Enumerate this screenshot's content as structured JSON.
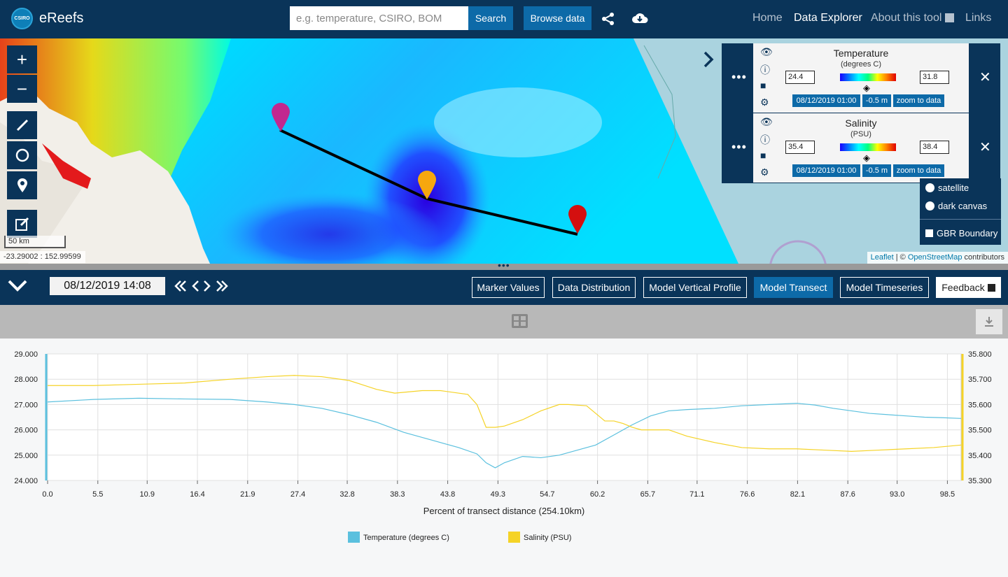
{
  "header": {
    "brand": "eReefs",
    "logo_text": "CSIRO",
    "search_placeholder": "e.g. temperature, CSIRO, BOM",
    "search_button": "Search",
    "browse_button": "Browse data",
    "nav": [
      "Home",
      "Data Explorer",
      "About this tool",
      "Links"
    ],
    "active_nav": "Data Explorer"
  },
  "map": {
    "scale_label": "50 km",
    "coords": "-23.29002 : 152.99599",
    "attribution_leaflet": "Leaflet",
    "attribution_sep": " | © ",
    "attribution_osm": "OpenStreetMap",
    "attribution_tail": " contributors",
    "markers": [
      "magenta",
      "orange",
      "red"
    ]
  },
  "layers": [
    {
      "title": "Temperature",
      "unit": "(degrees C)",
      "min": "24.4",
      "max": "31.8",
      "date": "08/12/2019 01:00",
      "depth": "-0.5 m",
      "zoom": "zoom to data"
    },
    {
      "title": "Salinity",
      "unit": "(PSU)",
      "min": "35.4",
      "max": "38.4",
      "date": "08/12/2019 01:00",
      "depth": "-0.5 m",
      "zoom": "zoom to data"
    }
  ],
  "basemap_options": [
    "satellite",
    "dark canvas",
    "GBR Boundary"
  ],
  "controls": {
    "datetime": "08/12/2019 14:08",
    "tabs": [
      "Marker Values",
      "Data Distribution",
      "Model Vertical Profile",
      "Model Transect",
      "Model Timeseries"
    ],
    "active_tab": "Model Transect",
    "feedback": "Feedback"
  },
  "chart_data": {
    "type": "line",
    "xlabel": "Percent of transect distance (254.10km)",
    "x_ticks": [
      "0.0",
      "5.5",
      "10.9",
      "16.4",
      "21.9",
      "27.4",
      "32.8",
      "38.3",
      "43.8",
      "49.3",
      "54.7",
      "60.2",
      "65.7",
      "71.1",
      "76.6",
      "82.1",
      "87.6",
      "93.0",
      "98.5"
    ],
    "xlim": [
      0,
      100
    ],
    "y_left_ticks": [
      "29.000",
      "28.000",
      "27.000",
      "26.000",
      "25.000",
      "24.000"
    ],
    "y_left_range": [
      24,
      29
    ],
    "y_right_ticks": [
      "35.800",
      "35.700",
      "35.600",
      "35.500",
      "35.400",
      "35.300"
    ],
    "y_right_range": [
      35.3,
      35.8
    ],
    "grid": true,
    "legend_position": "bottom",
    "series": [
      {
        "name": "Temperature (degrees C)",
        "color": "#5bc0de",
        "axis": "left",
        "x": [
          0,
          5,
          10,
          15,
          20,
          24,
          27,
          30,
          33,
          36,
          39,
          42,
          45,
          47,
          48,
          49,
          50,
          52,
          54,
          56,
          58,
          60,
          62,
          64,
          66,
          68,
          70,
          73,
          76,
          79,
          82,
          84,
          86,
          88,
          90,
          92,
          94,
          96,
          98,
          100
        ],
        "y": [
          27.1,
          27.2,
          27.25,
          27.22,
          27.2,
          27.1,
          27.0,
          26.85,
          26.6,
          26.3,
          25.9,
          25.6,
          25.3,
          25.05,
          24.7,
          24.5,
          24.7,
          24.95,
          24.9,
          25.0,
          25.2,
          25.4,
          25.8,
          26.2,
          26.55,
          26.75,
          26.8,
          26.85,
          26.95,
          27.0,
          27.05,
          26.98,
          26.85,
          26.75,
          26.65,
          26.6,
          26.55,
          26.5,
          26.48,
          26.45
        ]
      },
      {
        "name": "Salinity (PSU)",
        "color": "#f5d327",
        "axis": "right",
        "x": [
          0,
          5,
          10,
          15,
          20,
          24,
          27,
          30,
          33,
          36,
          38,
          41,
          43,
          46,
          47,
          48,
          49,
          50,
          52,
          54,
          56,
          57,
          59,
          60,
          61,
          62,
          63,
          64,
          65,
          68,
          70,
          73,
          76,
          79,
          82,
          85,
          88,
          91,
          94,
          97,
          100
        ],
        "y": [
          35.675,
          35.675,
          35.68,
          35.685,
          35.7,
          35.71,
          35.715,
          35.71,
          35.695,
          35.66,
          35.645,
          35.655,
          35.655,
          35.64,
          35.6,
          35.51,
          35.51,
          35.515,
          35.54,
          35.575,
          35.6,
          35.6,
          35.595,
          35.565,
          35.535,
          35.535,
          35.525,
          35.51,
          35.5,
          35.5,
          35.475,
          35.45,
          35.43,
          35.425,
          35.425,
          35.42,
          35.415,
          35.42,
          35.425,
          35.43,
          35.44
        ]
      }
    ]
  }
}
